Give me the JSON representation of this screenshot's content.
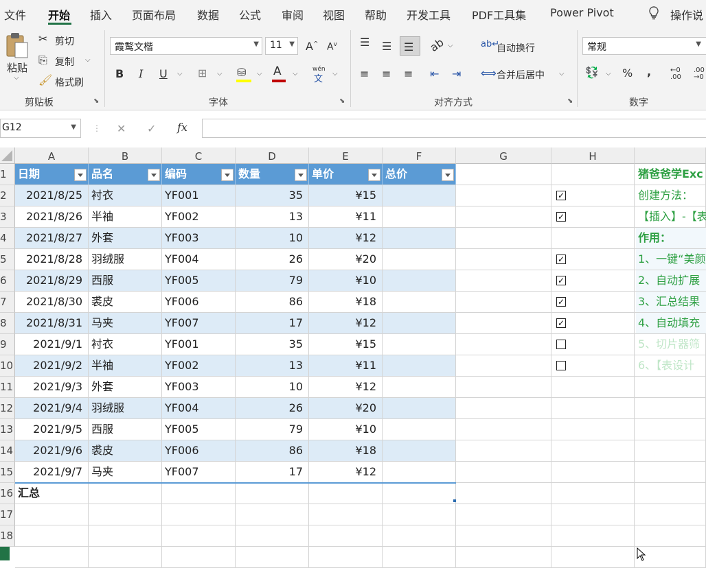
{
  "menu": {
    "tabs": [
      "文件",
      "开始",
      "插入",
      "页面布局",
      "数据",
      "公式",
      "审阅",
      "视图",
      "帮助",
      "开发工具",
      "PDF工具集",
      "Power Pivot"
    ],
    "active_tab": "开始",
    "tell_me": "操作说"
  },
  "ribbon": {
    "clipboard": {
      "paste": "粘贴",
      "cut": "剪切",
      "copy": "复制",
      "format_painter": "格式刷",
      "label": "剪贴板"
    },
    "font": {
      "name": "霞鹜文楷",
      "size": "11",
      "label": "字体",
      "bold": "B",
      "italic": "I",
      "underline": "U",
      "phonetic": "wén"
    },
    "alignment": {
      "wrap": "自动换行",
      "merge": "合并后居中",
      "label": "对齐方式"
    },
    "number": {
      "format": "常规",
      "label": "数字",
      "percent": "%",
      "comma": ","
    }
  },
  "formula_bar": {
    "name_box": "G12",
    "cancel": "✕",
    "enter": "✓",
    "fx": "fx",
    "value": ""
  },
  "columns": [
    "A",
    "B",
    "C",
    "D",
    "E",
    "F",
    "G",
    "H"
  ],
  "rows": [
    "1",
    "2",
    "3",
    "4",
    "5",
    "6",
    "7",
    "8",
    "9",
    "10",
    "11",
    "12",
    "13",
    "14",
    "15",
    "16",
    "17",
    "18"
  ],
  "table": {
    "headers": [
      "日期",
      "品名",
      "编码",
      "数量",
      "单价",
      "总价"
    ],
    "rows": [
      [
        "2021/8/25",
        "衬衣",
        "YF001",
        "35",
        "¥15",
        ""
      ],
      [
        "2021/8/26",
        "半袖",
        "YF002",
        "13",
        "¥11",
        ""
      ],
      [
        "2021/8/27",
        "外套",
        "YF003",
        "10",
        "¥12",
        ""
      ],
      [
        "2021/8/28",
        "羽绒服",
        "YF004",
        "26",
        "¥20",
        ""
      ],
      [
        "2021/8/29",
        "西服",
        "YF005",
        "79",
        "¥10",
        ""
      ],
      [
        "2021/8/30",
        "裘皮",
        "YF006",
        "86",
        "¥18",
        ""
      ],
      [
        "2021/8/31",
        "马夹",
        "YF007",
        "17",
        "¥12",
        ""
      ],
      [
        "2021/9/1",
        "衬衣",
        "YF001",
        "35",
        "¥15",
        ""
      ],
      [
        "2021/9/2",
        "半袖",
        "YF002",
        "13",
        "¥11",
        ""
      ],
      [
        "2021/9/3",
        "外套",
        "YF003",
        "10",
        "¥12",
        ""
      ],
      [
        "2021/9/4",
        "羽绒服",
        "YF004",
        "26",
        "¥20",
        ""
      ],
      [
        "2021/9/5",
        "西服",
        "YF005",
        "79",
        "¥10",
        ""
      ],
      [
        "2021/9/6",
        "裘皮",
        "YF006",
        "86",
        "¥18",
        ""
      ],
      [
        "2021/9/7",
        "马夹",
        "YF007",
        "17",
        "¥12",
        ""
      ]
    ],
    "total_label": "汇总"
  },
  "checkboxes": [
    true,
    true,
    null,
    true,
    true,
    true,
    true,
    false,
    false
  ],
  "notes": [
    "猪爸爸学Exc",
    "创建方法：",
    "【插入】-【表",
    "作用：",
    "1、一键“美颜",
    "2、自动扩展",
    "3、汇总结果",
    "4、自动填充",
    "5、切片器筛",
    "6、【表设计"
  ]
}
